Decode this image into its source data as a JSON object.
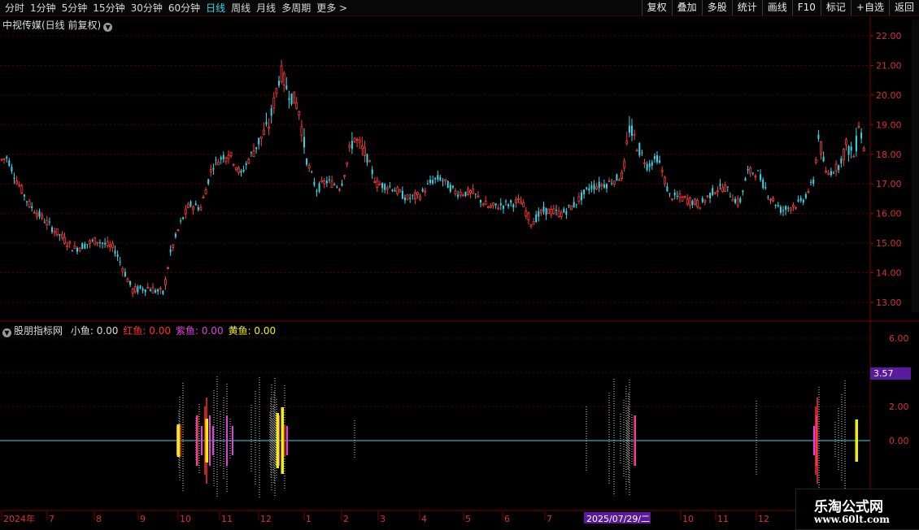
{
  "toolbar": {
    "periods": [
      {
        "label": "分时",
        "active": false
      },
      {
        "label": "1分钟",
        "active": false
      },
      {
        "label": "5分钟",
        "active": false
      },
      {
        "label": "15分钟",
        "active": false
      },
      {
        "label": "30分钟",
        "active": false
      },
      {
        "label": "60分钟",
        "active": false
      },
      {
        "label": "日线",
        "active": true
      },
      {
        "label": "周线",
        "active": false
      },
      {
        "label": "月线",
        "active": false
      },
      {
        "label": "多周期",
        "active": false
      },
      {
        "label": "更多 >",
        "active": false
      }
    ],
    "tools": [
      "复权",
      "叠加",
      "多股",
      "统计",
      "画线",
      "F10",
      "标记",
      "+自选",
      "返回"
    ]
  },
  "main_chart": {
    "title": "中视传媒(日线 前复权)",
    "price_axis": [
      "22.00",
      "21.00",
      "20.00",
      "19.00",
      "18.00",
      "17.00",
      "16.00",
      "15.00",
      "14.00",
      "13.00"
    ],
    "up_color": "#ff3b3b",
    "down_color": "#35d6e6"
  },
  "indicator": {
    "name": "股朋指标网",
    "items": [
      {
        "label": "小鱼:",
        "value": "0.00",
        "color": "#dddddd"
      },
      {
        "label": "红鱼:",
        "value": "0.00",
        "color": "#ff3030"
      },
      {
        "label": "紫鱼:",
        "value": "0.00",
        "color": "#e040e0"
      },
      {
        "label": "黄鱼:",
        "value": "0.00",
        "color": "#f0f000"
      }
    ],
    "axis": [
      "6.00",
      "4.00",
      "2.00",
      "0.00"
    ],
    "cursor_value": "3.57",
    "cursor_color": "#5a1a9e"
  },
  "time_axis": {
    "labels": [
      "2024年",
      "7",
      "8",
      "9",
      "10",
      "11",
      "12",
      "1",
      "2",
      "3",
      "4",
      "5",
      "6",
      "7",
      "10",
      "11",
      "12"
    ],
    "highlight": "2025/07/29/二",
    "highlight_color": "#5a1a9e"
  },
  "watermark": {
    "line1": "乐淘公式网",
    "line2": "www.60lt.com"
  },
  "chart_data": {
    "type": "candlestick",
    "ylim": [
      12.6,
      22.2
    ],
    "anchors": [
      [
        0,
        17.8
      ],
      [
        8,
        17.9
      ],
      [
        18,
        17.2
      ],
      [
        35,
        16.3
      ],
      [
        60,
        15.6
      ],
      [
        90,
        14.8
      ],
      [
        118,
        15.1
      ],
      [
        140,
        14.8
      ],
      [
        162,
        13.4
      ],
      [
        180,
        13.5
      ],
      [
        200,
        13.3
      ],
      [
        208,
        14.6
      ],
      [
        220,
        15.6
      ],
      [
        232,
        16.3
      ],
      [
        246,
        16.2
      ],
      [
        260,
        17.6
      ],
      [
        280,
        18.1
      ],
      [
        295,
        17.3
      ],
      [
        312,
        18.2
      ],
      [
        330,
        19.0
      ],
      [
        344,
        20.8
      ],
      [
        352,
        20.2
      ],
      [
        366,
        19.6
      ],
      [
        376,
        17.8
      ],
      [
        388,
        16.8
      ],
      [
        400,
        17.1
      ],
      [
        418,
        16.9
      ],
      [
        434,
        18.6
      ],
      [
        450,
        17.9
      ],
      [
        462,
        17.0
      ],
      [
        480,
        16.9
      ],
      [
        500,
        16.5
      ],
      [
        515,
        16.6
      ],
      [
        530,
        17.1
      ],
      [
        540,
        17.2
      ],
      [
        560,
        16.7
      ],
      [
        580,
        16.7
      ],
      [
        600,
        16.2
      ],
      [
        620,
        16.3
      ],
      [
        640,
        16.4
      ],
      [
        652,
        15.7
      ],
      [
        668,
        16.1
      ],
      [
        690,
        16.0
      ],
      [
        705,
        16.3
      ],
      [
        725,
        16.9
      ],
      [
        745,
        17.0
      ],
      [
        765,
        17.3
      ],
      [
        773,
        18.9
      ],
      [
        783,
        18.3
      ],
      [
        795,
        17.6
      ],
      [
        808,
        17.9
      ],
      [
        822,
        16.6
      ],
      [
        840,
        16.5
      ],
      [
        860,
        16.3
      ],
      [
        878,
        16.8
      ],
      [
        890,
        16.9
      ],
      [
        908,
        16.3
      ],
      [
        918,
        17.4
      ],
      [
        930,
        17.4
      ],
      [
        945,
        16.6
      ],
      [
        960,
        16.1
      ],
      [
        985,
        16.4
      ],
      [
        1000,
        17.1
      ],
      [
        1005,
        18.7
      ],
      [
        1015,
        17.3
      ],
      [
        1030,
        17.6
      ],
      [
        1040,
        18.3
      ],
      [
        1050,
        17.9
      ],
      [
        1055,
        19.1
      ],
      [
        1062,
        18.1
      ]
    ],
    "signals": {
      "white": [
        219,
        220,
        221,
        225,
        241,
        245,
        263,
        267,
        271,
        275,
        279,
        283,
        309,
        314,
        319,
        332,
        333,
        334,
        335,
        336,
        337,
        338,
        339,
        340,
        350,
        436,
        721,
        749,
        755,
        763,
        767,
        770,
        771,
        772,
        773,
        774,
        777,
        930,
        1007,
        1027,
        1031,
        1035,
        1039
      ],
      "magenta": [
        218,
        242,
        248,
        258,
        262,
        279,
        286,
        343,
        353,
        781,
        1001,
        1004
      ],
      "red": [
        222,
        243,
        252,
        254,
        350,
        780,
        1003,
        1005
      ],
      "yellow": [
        219,
        254,
        341,
        347,
        1053
      ]
    }
  }
}
